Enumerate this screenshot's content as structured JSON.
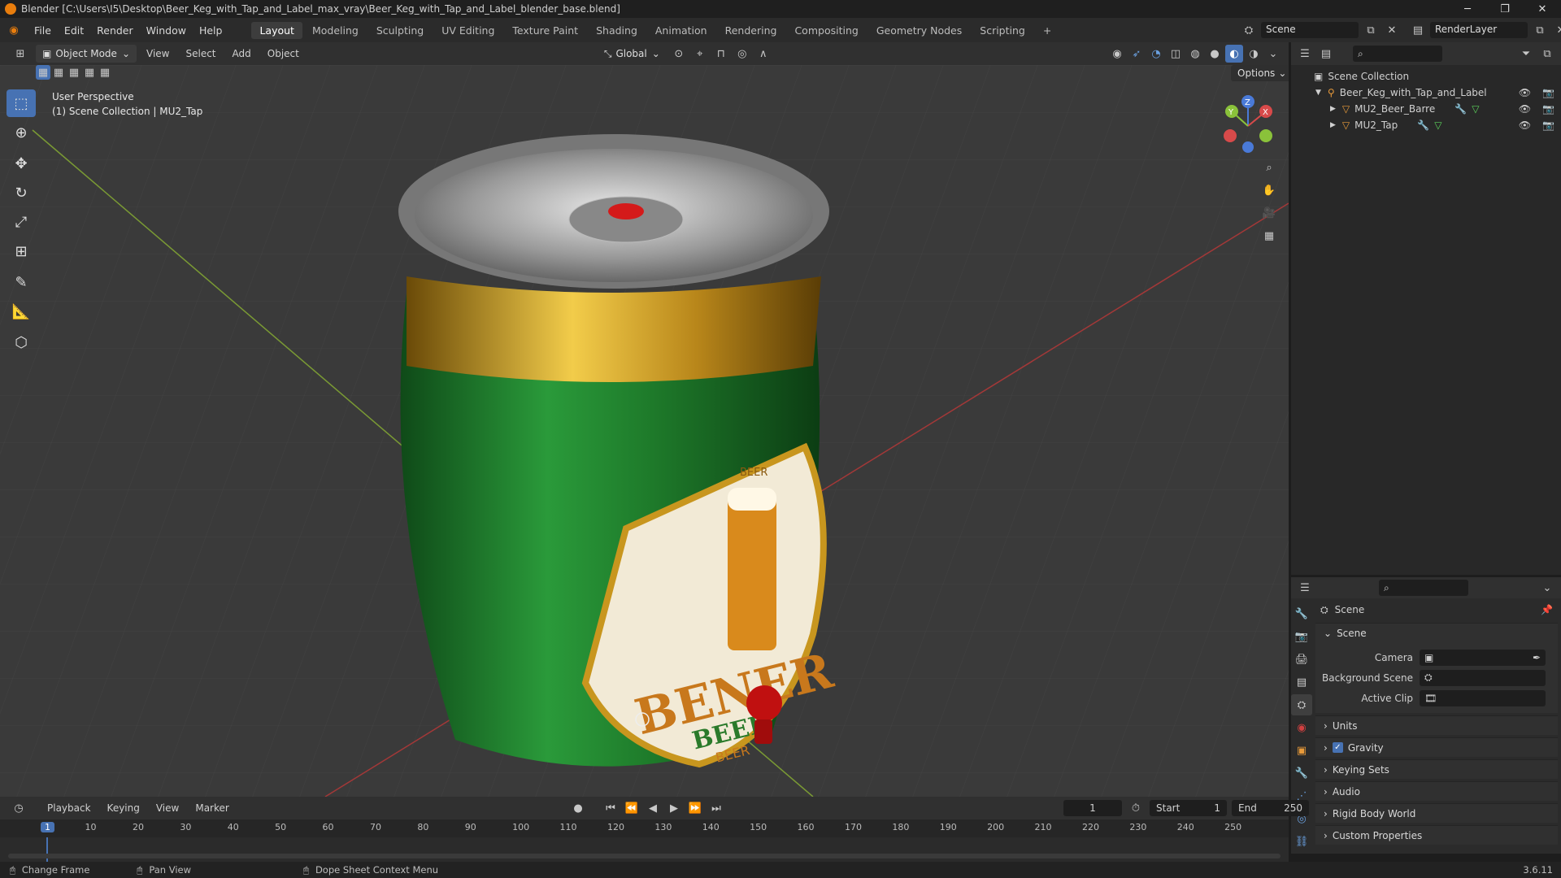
{
  "window": {
    "title": "Blender [C:\\Users\\I5\\Desktop\\Beer_Keg_with_Tap_and_Label_max_vray\\Beer_Keg_with_Tap_and_Label_blender_base.blend]",
    "minimize": "─",
    "maximize": "❐",
    "close": "✕"
  },
  "menu": {
    "items": [
      "File",
      "Edit",
      "Render",
      "Window",
      "Help"
    ]
  },
  "workspaces": [
    "Layout",
    "Modeling",
    "Sculpting",
    "UV Editing",
    "Texture Paint",
    "Shading",
    "Animation",
    "Rendering",
    "Compositing",
    "Geometry Nodes",
    "Scripting"
  ],
  "workspace_add": "+",
  "scene_selector": {
    "value": "Scene"
  },
  "renderlayer_selector": {
    "value": "RenderLayer"
  },
  "viewport_header": {
    "mode": "Object Mode",
    "menus": [
      "View",
      "Select",
      "Add",
      "Object"
    ],
    "transform": "Global",
    "options": "Options"
  },
  "viewport_overlay": {
    "perspective": "User Perspective",
    "collection": "(1) Scene Collection | MU2_Tap"
  },
  "gizmo": {
    "z": "Z",
    "y": "Y",
    "x": "X"
  },
  "label_texts": {
    "top": "BEER",
    "big": "BENER",
    "mid": "BEER",
    "small": "BEER"
  },
  "outliner": {
    "root": "Scene Collection",
    "items": [
      {
        "name": "Beer_Keg_with_Tap_and_Label",
        "level": 0
      },
      {
        "name": "MU2_Beer_Barre",
        "level": 1
      },
      {
        "name": "MU2_Tap",
        "level": 1
      }
    ]
  },
  "properties": {
    "context": "Scene",
    "panel": "Scene",
    "fields": [
      {
        "label": "Camera"
      },
      {
        "label": "Background Scene"
      },
      {
        "label": "Active Clip"
      }
    ],
    "sections": [
      {
        "label": "Units",
        "checkbox": false
      },
      {
        "label": "Gravity",
        "checkbox": true
      },
      {
        "label": "Keying Sets",
        "checkbox": false
      },
      {
        "label": "Audio",
        "checkbox": false
      },
      {
        "label": "Rigid Body World",
        "checkbox": false
      },
      {
        "label": "Custom Properties",
        "checkbox": false
      }
    ]
  },
  "timeline": {
    "menus": [
      "Playback",
      "Keying",
      "View",
      "Marker"
    ],
    "current_frame": "1",
    "start_label": "Start",
    "start": "1",
    "end_label": "End",
    "end": "250",
    "ticks": [
      "1",
      "10",
      "20",
      "30",
      "40",
      "50",
      "60",
      "70",
      "80",
      "90",
      "100",
      "110",
      "120",
      "130",
      "140",
      "150",
      "160",
      "170",
      "180",
      "190",
      "200",
      "210",
      "220",
      "230",
      "240",
      "250"
    ]
  },
  "status": {
    "left": "Change Frame",
    "mid": "Pan View",
    "right": "Dope Sheet Context Menu",
    "version": "3.6.11"
  },
  "colors": {
    "accent": "#4772b3",
    "keg_green": "#1e7a2a",
    "gold": "#c8961e",
    "tap_red": "#d01818"
  }
}
